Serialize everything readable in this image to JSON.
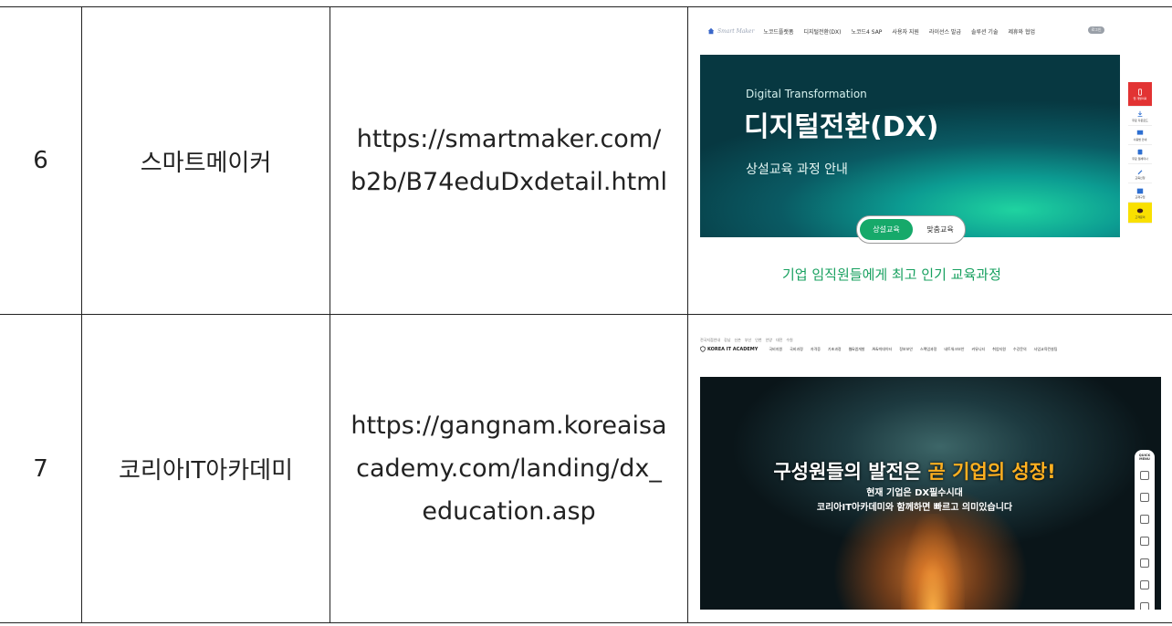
{
  "rows": [
    {
      "number": "6",
      "name": "스마트메이커",
      "url_lines": [
        "https://smartmaker.com/",
        "b2b/B74eduDxdetail.html"
      ],
      "screenshot": {
        "logo_text": "Smart Maker",
        "nav": [
          "노코드플랫폼",
          "디지털전환(DX)",
          "노코드4 SAP",
          "사용자 지원",
          "라이선스 발급",
          "솔루션 기술",
          "제휴와 협업"
        ],
        "login_label": "로그인",
        "hero_subtitle": "Digital Transformation",
        "hero_title": "디지털전환(DX)",
        "hero_desc": "상설교육 과정 안내",
        "tab_active": "상설교육",
        "tab_inactive": "맞춤교육",
        "tagline": "기업 임직원들에게 최고 인기 교육과정",
        "side_items": [
          "앱 개발의뢰",
          "무료 다운로드",
          "사용법 안내",
          "무료 웹세미나",
          "교육신청",
          "교재구입",
          "고객문의"
        ],
        "accent": "#16a96a",
        "hero_color": "#0a5a63"
      }
    },
    {
      "number": "7",
      "name": "코리아IT아카데미",
      "url_lines": [
        "https://gangnam.koreaisa",
        "cademy.com/landing/dx_",
        "education.asp"
      ],
      "screenshot": {
        "top_links": [
          "전국지점안내",
          "강남",
          "신촌",
          "부산",
          "인천",
          "안양",
          "대전",
          "수원"
        ],
        "logo_text": "KOREA IT ACADEMY",
        "nav": [
          "국비지원",
          "국비과정",
          "자격증",
          "기초과정",
          "웹&앱개발",
          "AI&빅데이터",
          "정보보안",
          "스펙업과정",
          "네트워크보안",
          "커뮤니티",
          "취업지원",
          "수강문의",
          "사업교육컨설팅"
        ],
        "hero_title_a": "구성원들의 발전은 ",
        "hero_title_b": "곧 기업의 성장!",
        "hero_line1": "현재 기업은 DX필수시대",
        "hero_line2": "코리아IT아카데미와 함께하면 빠르고 의미있습니다",
        "quick_menu_label": "QUICK MENU",
        "highlight_color": "#ffb020"
      }
    }
  ]
}
